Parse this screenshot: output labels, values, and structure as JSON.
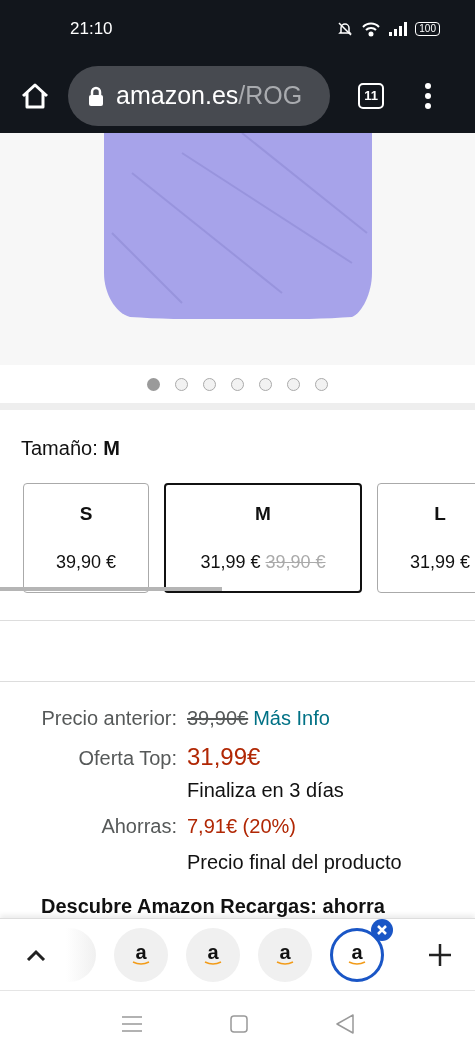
{
  "status_bar": {
    "time": "21:10",
    "battery": "100"
  },
  "browser": {
    "url_host": "amazon.es",
    "url_path": "/ROG",
    "tab_count": "11"
  },
  "gallery": {
    "dots": [
      {
        "selected": true
      },
      {
        "selected": false
      },
      {
        "selected": false
      },
      {
        "selected": false
      },
      {
        "selected": false
      },
      {
        "selected": false
      },
      {
        "selected": false
      }
    ]
  },
  "size": {
    "label": "Tamaño: ",
    "value": "M",
    "options": [
      {
        "name": "S",
        "price": "39,90 €",
        "selected": false
      },
      {
        "name": "M",
        "price": "31,99 €",
        "old_price": "39,90 €",
        "selected": true
      },
      {
        "name": "L",
        "price": "31,99 €",
        "selected": false
      }
    ]
  },
  "pricing": [
    {
      "label": "Precio anterior:",
      "kind": "old",
      "value": "39,90€",
      "link": "Más Info"
    },
    {
      "label": "Oferta Top:",
      "kind": "deal",
      "value": "31,99€"
    },
    {
      "kind": "note",
      "value": "Finaliza en 3 días"
    },
    {
      "label": "Ahorras:",
      "kind": "deal_small",
      "value": "7,91€ (20%)"
    },
    {
      "kind": "note",
      "value": "Precio final del producto"
    }
  ],
  "promo_heading": "Descubre Amazon Recargas: ahorra",
  "tab_strip": {
    "tabs": [
      {
        "kind": "partial",
        "selected": false
      },
      {
        "kind": "full",
        "favicon": "a",
        "selected": false
      },
      {
        "kind": "full",
        "favicon": "a",
        "selected": false
      },
      {
        "kind": "full",
        "favicon": "a",
        "selected": false
      },
      {
        "kind": "full",
        "favicon": "a",
        "selected": true
      }
    ]
  }
}
